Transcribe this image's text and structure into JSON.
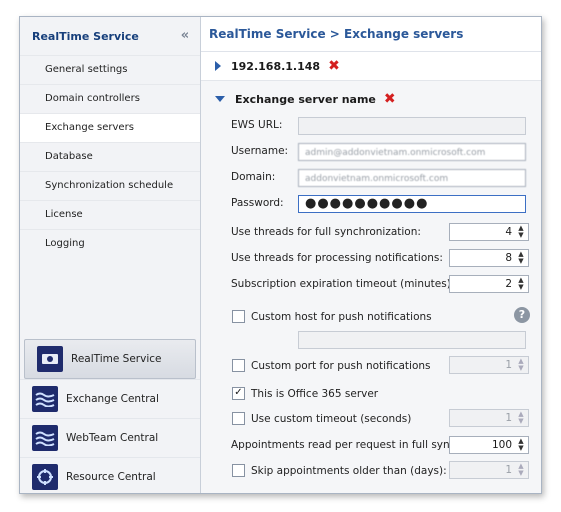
{
  "sidebar": {
    "header": "RealTime Service",
    "collapse_icon": "«",
    "items": [
      {
        "label": "General settings"
      },
      {
        "label": "Domain controllers"
      },
      {
        "label": "Exchange servers"
      },
      {
        "label": "Database"
      },
      {
        "label": "Synchronization schedule"
      },
      {
        "label": "License"
      },
      {
        "label": "Logging"
      }
    ],
    "apps": [
      {
        "label": "RealTime Service",
        "icon": "realtime-service-icon"
      },
      {
        "label": "Exchange Central",
        "icon": "exchange-central-icon"
      },
      {
        "label": "WebTeam Central",
        "icon": "webteam-central-icon"
      },
      {
        "label": "Resource Central",
        "icon": "resource-central-icon"
      }
    ]
  },
  "breadcrumb": "RealTime Service > Exchange servers",
  "server": {
    "name": "192.168.1.148"
  },
  "section": {
    "title": "Exchange server name"
  },
  "form": {
    "ews_url_label": "EWS URL:",
    "ews_url_value": "",
    "username_label": "Username:",
    "username_value": "admin@addonvietnam.onmicrosoft.com",
    "domain_label": "Domain:",
    "domain_value": "addonvietnam.onmicrosoft.com",
    "password_label": "Password:",
    "password_value": "●●●●●●●●●●",
    "threads_full_label": "Use threads for full synchronization:",
    "threads_full_value": "4",
    "threads_notif_label": "Use threads for processing notifications:",
    "threads_notif_value": "8",
    "sub_timeout_label": "Subscription expiration timeout (minutes):",
    "sub_timeout_value": "2",
    "custom_host_label": "Custom host for push notifications",
    "custom_host_value": "",
    "custom_port_label": "Custom port for push notifications",
    "custom_port_value": "1",
    "office365_label": "This is Office 365 server",
    "custom_timeout_label": "Use custom timeout (seconds)",
    "custom_timeout_value": "1",
    "appointments_label": "Appointments read per request in full sync:",
    "appointments_value": "100",
    "skip_label": "Skip appointments older than (days):",
    "skip_value": "1"
  },
  "colors": {
    "accent": "#2b5899",
    "delete": "#d42020"
  }
}
